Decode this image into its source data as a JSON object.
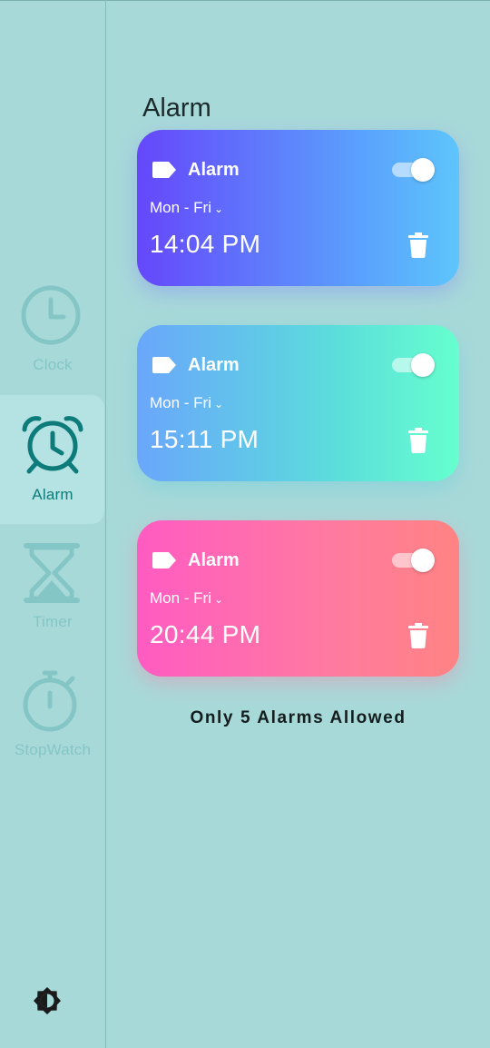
{
  "sidebar": {
    "items": [
      {
        "label": "Clock",
        "icon": "clock-icon",
        "active": false
      },
      {
        "label": "Alarm",
        "icon": "alarm-clock-icon",
        "active": true
      },
      {
        "label": "Timer",
        "icon": "hourglass-icon",
        "active": false
      },
      {
        "label": "StopWatch",
        "icon": "stopwatch-icon",
        "active": false
      }
    ],
    "theme_icon": "brightness-icon"
  },
  "page": {
    "title": "Alarm"
  },
  "alarms": [
    {
      "name": "Alarm",
      "days": "Mon - Fri",
      "time": "14:04 PM",
      "enabled": true
    },
    {
      "name": "Alarm",
      "days": "Mon - Fri",
      "time": "15:11 PM",
      "enabled": true
    },
    {
      "name": "Alarm",
      "days": "Mon - Fri",
      "time": "20:44 PM",
      "enabled": true
    }
  ],
  "footer": {
    "note": "Only 5 Alarms Allowed"
  },
  "colors": {
    "background": "#a8d9d9",
    "active_nav": "#0e7b7b",
    "inactive_nav": "#84c6c6",
    "card1_gradient": [
      "#6547fb",
      "#5ec5fc"
    ],
    "card2_gradient": [
      "#6aa6fb",
      "#66ffce"
    ],
    "card3_gradient": [
      "#ff5bc2",
      "#ff8383"
    ]
  }
}
